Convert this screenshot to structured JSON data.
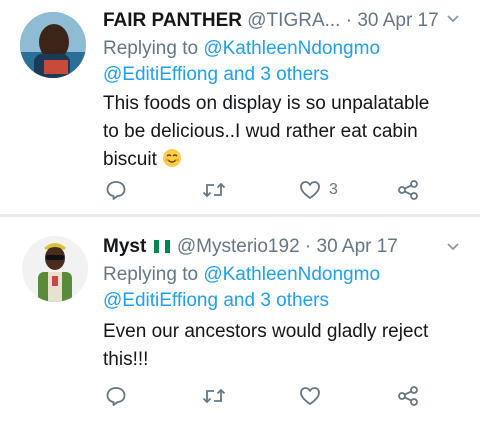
{
  "tweets": [
    {
      "name": "FAIR PANTHER",
      "handle": "@TIGRA...",
      "date": "· 30 Apr 17",
      "replying_prefix": "Replying to ",
      "replying_to": "@KathleenNdongmo",
      "replying_others": "@EditiEffiong and 3 others",
      "text_line1": "This foods on display is so unpalatable",
      "text_line2": "to be delicious..I wud rather eat cabin",
      "text_line3": "biscuit",
      "emoji": "😊",
      "like_count": "3"
    },
    {
      "name": "Myst",
      "handle": "@Mysterio192",
      "date": "· 30 Apr 17",
      "replying_prefix": "Replying to ",
      "replying_to": "@KathleenNdongmo",
      "replying_others": "@EditiEffiong and 3 others",
      "text_line1": "Even our ancestors would gladly reject",
      "text_line2": "this!!!",
      "like_count": ""
    }
  ],
  "colors": {
    "accent": "#1da1f2",
    "muted": "#657786",
    "text": "#14171a",
    "divider": "#e6ecf0",
    "flag_green": "#008751"
  },
  "icons": [
    "reply-icon",
    "retweet-icon",
    "like-icon",
    "share-icon",
    "chevron-down-icon",
    "nigeria-flag-icon"
  ]
}
